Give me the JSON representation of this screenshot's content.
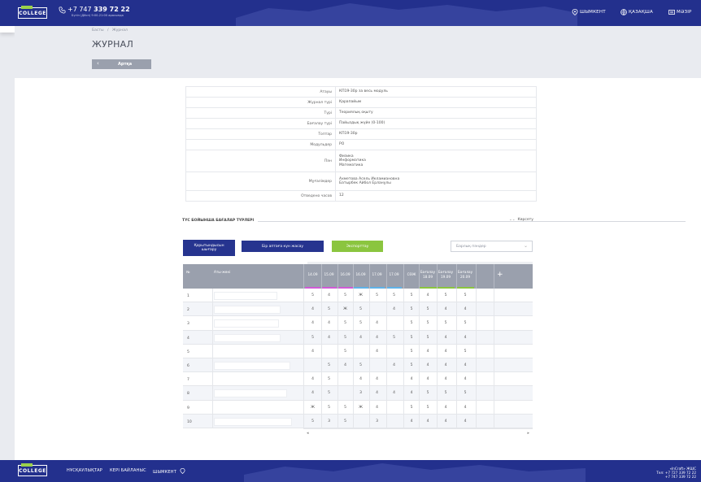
{
  "header": {
    "logo_tag": "smart",
    "logo_text": "COLLEGE",
    "phone_prefix": "+7 747 ",
    "phone_bold": "339 72 22",
    "hours": "Бүгін (Дйсн) 9:00-21:00 арасында",
    "nav": [
      {
        "label": "ШЫМКЕНТ",
        "icon": "location-pin-icon"
      },
      {
        "label": "ҚАЗАҚША",
        "icon": "globe-icon"
      },
      {
        "label": "МӘЗІР",
        "icon": "menu-icon"
      }
    ]
  },
  "breadcrumb": [
    "Басты",
    "/",
    "Журнал"
  ],
  "page_title": "ЖУРНАЛ",
  "back_label": "Артқа",
  "info_rows": [
    {
      "key": "Атауы",
      "value": "КП19-30р за весь модуль"
    },
    {
      "key": "Журнал түрі",
      "value": "Қарапайым"
    },
    {
      "key": "Түрі",
      "value": "Теориялық оқыту"
    },
    {
      "key": "Бағалау түрі",
      "value": "Пайыздық жүйе (0-100)"
    },
    {
      "key": "Топтар",
      "value": "КП19-30р"
    },
    {
      "key": "Модульдер",
      "value": "РО"
    },
    {
      "key": "Пән",
      "value": [
        "Физика",
        "Информатика",
        "Математика"
      ]
    },
    {
      "key": "Мұғалімдер",
      "value": [
        "Ахметова Асель Икламиановна",
        "Батырбек Айбол Ерланұлы"
      ]
    },
    {
      "key": "Отведено часов",
      "value": "12"
    }
  ],
  "section": {
    "title": "ТҮС БОЙЫНША БАҒАЛАР ТҮРЛЕРІ",
    "show": "Көрсету"
  },
  "buttons": {
    "summary": [
      "Қорытындысын",
      "шығару"
    ],
    "weekly": "Бір аптаға күн жасау",
    "export": "Экспорттау"
  },
  "select": {
    "value": "Барлық пәндер"
  },
  "grade_table": {
    "col_num": "№",
    "col_name": "Аты-жөні",
    "dates": [
      "14.09",
      "15.09",
      "16.09",
      "16.09",
      "17.09",
      "17.09"
    ],
    "col_srs": "СӨЖ",
    "extra_cols": [
      [
        "Бағалау",
        "18.09"
      ],
      [
        "Бағалау",
        "19.09"
      ],
      [
        "Бағалау",
        "20.09"
      ]
    ],
    "plus": "+",
    "date_accent": [
      "#d05bd6",
      "#d05bd6",
      "#d05bd6",
      "#5fb2e8",
      "#5fb2e8",
      "#5fb2e8"
    ],
    "extra_accent": [
      "#8bc53f",
      "#8bc53f",
      "#8bc53f"
    ],
    "rows": [
      {
        "n": "1",
        "g": [
          "5",
          "4",
          "5",
          "Ж",
          "5",
          "5",
          "5",
          "4",
          "5",
          "5"
        ]
      },
      {
        "n": "2",
        "g": [
          "4",
          "5",
          "Ж",
          "5",
          "",
          "4",
          "5",
          "5",
          "4",
          "4"
        ]
      },
      {
        "n": "3",
        "g": [
          "4",
          "4",
          "5",
          "5",
          "4",
          "",
          "5",
          "5",
          "5",
          "5"
        ]
      },
      {
        "n": "4",
        "g": [
          "5",
          "4",
          "5",
          "4",
          "4",
          "5",
          "5",
          "5",
          "4",
          "4"
        ]
      },
      {
        "n": "5",
        "g": [
          "4",
          "",
          "5",
          "",
          "4",
          "",
          "5",
          "4",
          "4",
          "5"
        ]
      },
      {
        "n": "6",
        "g": [
          "",
          "5",
          "4",
          "5",
          "",
          "4",
          "5",
          "4",
          "4",
          "4"
        ]
      },
      {
        "n": "7",
        "g": [
          "4",
          "5",
          "",
          "4",
          "4",
          "",
          "4",
          "4",
          "4",
          "4"
        ]
      },
      {
        "n": "8",
        "g": [
          "4",
          "5",
          "",
          "3",
          "4",
          "4",
          "4",
          "5",
          "5",
          "5"
        ]
      },
      {
        "n": "9",
        "g": [
          "Ж",
          "5",
          "5",
          "Ж",
          "4",
          "",
          "5",
          "5",
          "4",
          "4"
        ]
      },
      {
        "n": "10",
        "g": [
          "5",
          "3",
          "5",
          "",
          "3",
          "",
          "4",
          "4",
          "4",
          "4"
        ]
      }
    ]
  },
  "footer": {
    "nav": [
      "НҰСҚАУЛЫҚТАР",
      "КЕРІ БАЙЛАНЫС",
      "ШЫМКЕНТ"
    ],
    "company": "«InCraft» ЖШС",
    "phone1": "Тел: +7 727 339 72 22",
    "phone2": "+7 747 339 72 22"
  }
}
